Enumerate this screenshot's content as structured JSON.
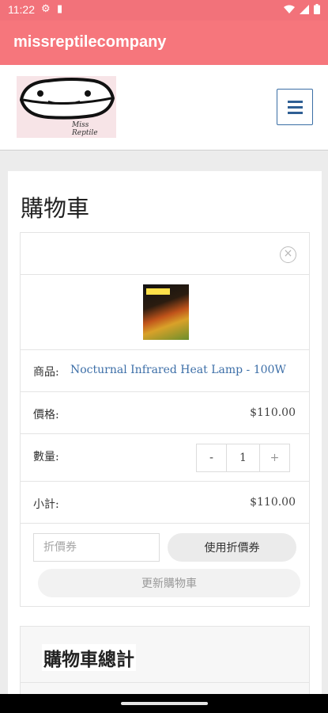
{
  "status_bar": {
    "time": "11:22"
  },
  "app_bar": {
    "title": "missreptilecompany"
  },
  "header": {
    "logo_signature": "Miss Reptile"
  },
  "cart": {
    "page_title": "購物車",
    "product_label": "商品:",
    "product_name": "Nocturnal Infrared Heat Lamp - 100W",
    "price_label": "價格:",
    "price": "$110.00",
    "qty_label": "數量:",
    "qty_minus": "-",
    "qty_value": "1",
    "qty_plus": "+",
    "subtotal_label": "小計:",
    "subtotal": "$110.00",
    "coupon_placeholder": "折價券",
    "apply_coupon": "使用折價券",
    "update_cart": "更新購物車"
  },
  "totals": {
    "title": "購物車總計"
  },
  "colors": {
    "brand": "#f6767c",
    "link": "#3d6fa8"
  }
}
